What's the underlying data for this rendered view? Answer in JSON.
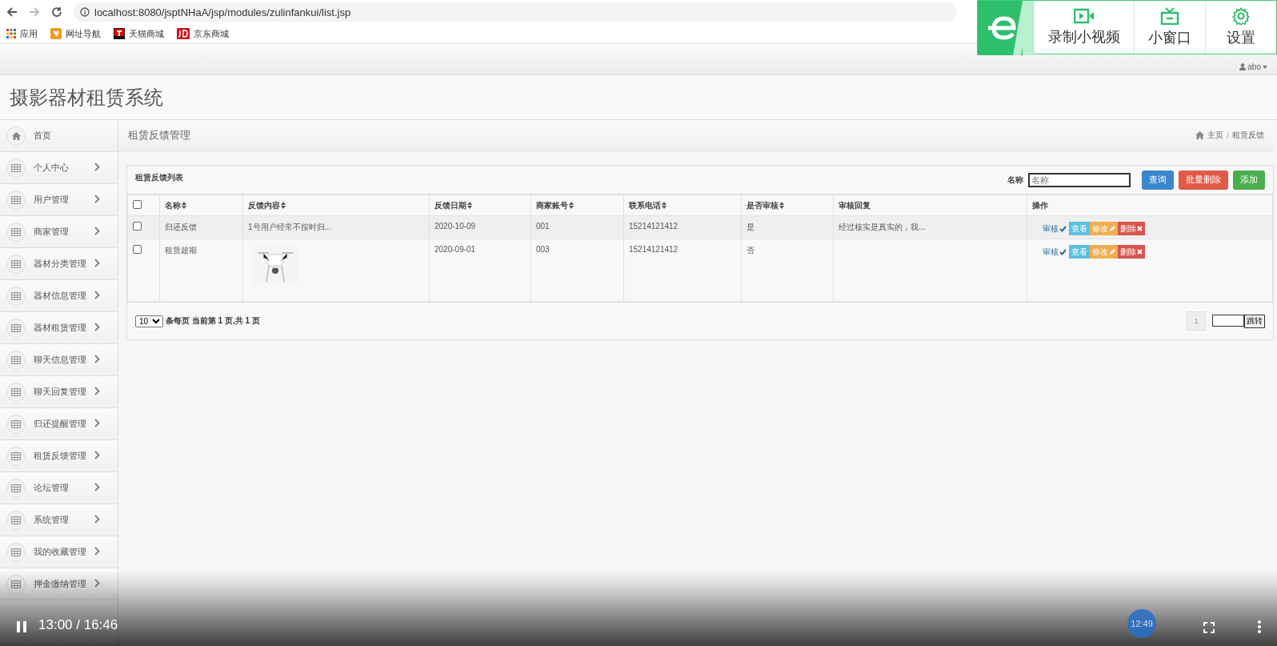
{
  "browser": {
    "url": "localhost:8080/jsptNHaA/jsp/modules/zulinfankui/list.jsp",
    "bookmarks": [
      {
        "label": "应用",
        "kind": "apps"
      },
      {
        "label": "网址导航",
        "kind": "nav"
      },
      {
        "label": "天猫商城",
        "kind": "tmall"
      },
      {
        "label": "京东商城",
        "kind": "jd"
      }
    ]
  },
  "extension": {
    "buttons": [
      {
        "label": "录制小视频",
        "kind": "record"
      },
      {
        "label": "小窗口",
        "kind": "tv"
      },
      {
        "label": "设置",
        "kind": "settings"
      }
    ]
  },
  "header": {
    "user": "abo",
    "title": "摄影器材租赁系统"
  },
  "sidebar": {
    "items": [
      {
        "label": "首页",
        "kind": "home"
      },
      {
        "label": "个人中心",
        "kind": "menu"
      },
      {
        "label": "用户管理",
        "kind": "menu"
      },
      {
        "label": "商家管理",
        "kind": "menu"
      },
      {
        "label": "器材分类管理",
        "kind": "menu"
      },
      {
        "label": "器材信息管理",
        "kind": "menu"
      },
      {
        "label": "器材租赁管理",
        "kind": "menu"
      },
      {
        "label": "聊天信息管理",
        "kind": "menu"
      },
      {
        "label": "聊天回复管理",
        "kind": "menu"
      },
      {
        "label": "归还提醒管理",
        "kind": "menu"
      },
      {
        "label": "租赁反馈管理",
        "kind": "menu"
      },
      {
        "label": "论坛管理",
        "kind": "menu"
      },
      {
        "label": "系统管理",
        "kind": "menu"
      },
      {
        "label": "我的收藏管理",
        "kind": "menu"
      },
      {
        "label": "押金缴纳管理",
        "kind": "menu"
      }
    ]
  },
  "page": {
    "title": "租赁反馈管理",
    "breadcrumb": [
      "主页",
      "租赁反馈"
    ],
    "breadcrumb_separator": "/"
  },
  "panel": {
    "title": "租赁反馈列表",
    "search_label": "名称",
    "search_placeholder": "名称",
    "buttons": [
      {
        "label": "查询",
        "kind": "primary"
      },
      {
        "label": "批量删除",
        "kind": "danger"
      },
      {
        "label": "添加",
        "kind": "success"
      }
    ]
  },
  "table": {
    "select_all_checked": false,
    "columns": [
      {
        "label": "名称",
        "sortable": true
      },
      {
        "label": "反馈内容",
        "sortable": true
      },
      {
        "label": "反馈日期",
        "sortable": true
      },
      {
        "label": "商家账号",
        "sortable": true
      },
      {
        "label": "联系电话",
        "sortable": true
      },
      {
        "label": "是否审核",
        "sortable": true
      },
      {
        "label": "审核回复",
        "sortable": false
      },
      {
        "label": "操作",
        "sortable": false
      }
    ],
    "rows": [
      {
        "checked": false,
        "name": "归还反馈",
        "content": {
          "kind": "text",
          "text": "1号用户经常不按时归..."
        },
        "date": "2020-10-09",
        "merchant": "001",
        "phone": "15214121412",
        "reviewed": "是",
        "reply": "经过核实是真实的，我...",
        "actions": [
          "审核",
          "查看",
          "修改",
          "删除"
        ]
      },
      {
        "checked": false,
        "name": "租赁超期",
        "date": "2020-09-01",
        "merchant": "003",
        "phone": "15214121412",
        "reviewed": "否",
        "actions": [
          "审核",
          "查看",
          "修改",
          "删除"
        ]
      }
    ]
  },
  "pagination": {
    "page_size": "10",
    "info": "条每页 当前第 1 页,共 1 页",
    "pages": [
      "1"
    ],
    "jump": "跳转"
  },
  "video": {
    "time": "13:00 / 16:46",
    "badge": "12:49"
  }
}
